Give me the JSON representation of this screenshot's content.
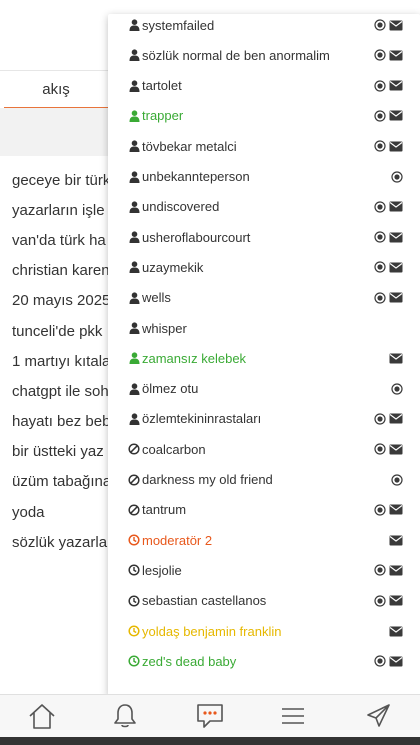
{
  "tabs": {
    "akis": "akış"
  },
  "background_entries": [
    "geceye bir türk",
    "yazarların işle",
    "van'da türk ha",
    "christian karen",
    "20 mayıs 2025",
    "tunceli'de pkk",
    "1 martıyı kıtala",
    "chatgpt ile soh",
    "hayatı bez beb",
    "bir üstteki yaz",
    "üzüm tabağına",
    "yoda",
    "sözlük yazarla"
  ],
  "colors": {
    "default": "#333333",
    "green": "#3aaa35",
    "orange": "#e8581c",
    "yellow": "#e6b800",
    "accent": "#e8743b",
    "icon": "#3a3a3a"
  },
  "users": [
    {
      "name": "systemfailed",
      "icon": "user-icon",
      "color": "default",
      "actions": [
        "eye",
        "mail"
      ]
    },
    {
      "name": "sözlük normal de ben anormalim",
      "icon": "user-icon",
      "color": "default",
      "actions": [
        "eye",
        "mail"
      ]
    },
    {
      "name": "tartolet",
      "icon": "user-icon",
      "color": "default",
      "actions": [
        "eye",
        "mail"
      ]
    },
    {
      "name": "trapper",
      "icon": "user-icon",
      "color": "green",
      "actions": [
        "eye",
        "mail"
      ]
    },
    {
      "name": "tövbekar metalci",
      "icon": "user-icon",
      "color": "default",
      "actions": [
        "eye",
        "mail"
      ]
    },
    {
      "name": "unbekannteperson",
      "icon": "user-icon",
      "color": "default",
      "actions": [
        "eye"
      ]
    },
    {
      "name": "undiscovered",
      "icon": "user-icon",
      "color": "default",
      "actions": [
        "eye",
        "mail"
      ]
    },
    {
      "name": "usheroflabourcourt",
      "icon": "user-icon",
      "color": "default",
      "actions": [
        "eye",
        "mail"
      ]
    },
    {
      "name": "uzaymekik",
      "icon": "user-icon",
      "color": "default",
      "actions": [
        "eye",
        "mail"
      ]
    },
    {
      "name": "wells",
      "icon": "user-icon",
      "color": "default",
      "actions": [
        "eye",
        "mail"
      ]
    },
    {
      "name": "whisper",
      "icon": "user-icon",
      "color": "default",
      "actions": []
    },
    {
      "name": "zamansız kelebek",
      "icon": "user-icon",
      "color": "green",
      "actions": [
        "mail"
      ]
    },
    {
      "name": "ölmez otu",
      "icon": "user-icon",
      "color": "default",
      "actions": [
        "eye"
      ]
    },
    {
      "name": "özlemtekininrastaları",
      "icon": "user-icon",
      "color": "default",
      "actions": [
        "eye",
        "mail"
      ]
    },
    {
      "name": "coalcarbon",
      "icon": "ban-icon",
      "color": "default",
      "actions": [
        "eye",
        "mail"
      ]
    },
    {
      "name": "darkness my old friend",
      "icon": "ban-icon",
      "color": "default",
      "actions": [
        "eye"
      ]
    },
    {
      "name": "tantrum",
      "icon": "ban-icon",
      "color": "default",
      "actions": [
        "eye",
        "mail"
      ]
    },
    {
      "name": "moderatör 2",
      "icon": "clock-icon",
      "color": "orange",
      "actions": [
        "mail"
      ]
    },
    {
      "name": "lesjolie",
      "icon": "clock-icon",
      "color": "default",
      "actions": [
        "eye",
        "mail"
      ]
    },
    {
      "name": "sebastian castellanos",
      "icon": "clock-icon",
      "color": "default",
      "actions": [
        "eye",
        "mail"
      ]
    },
    {
      "name": "yoldaş benjamin franklin",
      "icon": "clock-icon",
      "color": "yellow",
      "actions": [
        "mail"
      ]
    },
    {
      "name": "zed's dead baby",
      "icon": "clock-icon",
      "color": "green",
      "actions": [
        "eye",
        "mail"
      ]
    }
  ],
  "bottom_nav": [
    "home-icon",
    "bell-icon",
    "chat-icon",
    "menu-icon",
    "plane-icon"
  ]
}
